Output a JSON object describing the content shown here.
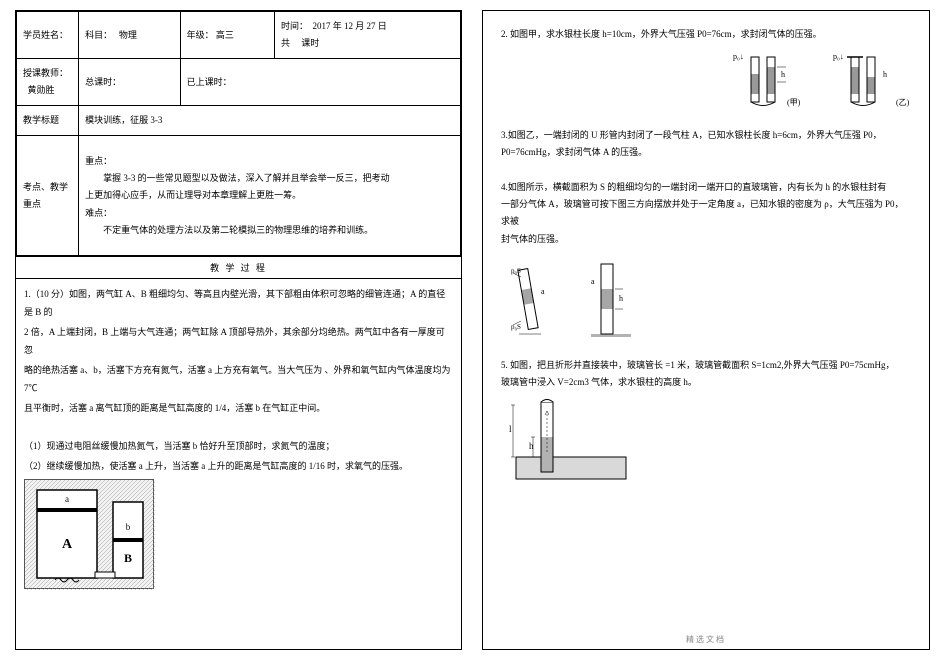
{
  "header": {
    "student_name_label": "学员姓名：",
    "subject_label": "科目：",
    "subject_value": "物理",
    "grade_label": "年级：",
    "grade_value": "高三",
    "time_label": "时间：",
    "time_value": "2017 年 12 月 27 日",
    "total_periods_label": "共",
    "total_periods_unit": "课时",
    "teacher_label": "授课教师：",
    "teacher_value": "黄勋胜",
    "total_lessons_label": "总课时：",
    "attended_lessons_label": "已上课时：",
    "goal_label": "教学标题",
    "goal_value": "模块训练，征服 3-3",
    "keypoint_label": "考点、教学重点",
    "keypoint_intro": "重点：",
    "keypoint_line1": "掌握 3-3 的一些常见题型以及做法，深入了解并且举会举一反三，把考动",
    "keypoint_line2": "上更加得心应手，从而让理导对本章理解上更胜一筹。",
    "difficult_intro": "难点：",
    "difficult_value": "不定重气体的处理方法以及第二轮模拟三的物理思维的培养和训练。",
    "process_title": "教 学 过 程"
  },
  "left_body": {
    "q1_head": "1.（10 分）如图，两气缸 A、B 粗细均匀、等高且内壁光滑，其下部粗由体积可忽略的细管连通；A 的直径是 B 的",
    "q1_l2": "2 倍，A 上端封闭，B 上端与大气连通；两气缸除 A 顶部导热外，其余部分均绝热。两气缸中各有一厚度可忽",
    "q1_l3": "略的绝热活塞 a、b，活塞下方充有氮气，活塞 a 上方充有氧气。当大气压为 、外界和氧气缸内气体温度均为 7℃",
    "q1_l4": "且平衡时，活塞 a 离气缸顶的距离是气缸高度的 1/4，活塞 b 在气缸正中间。",
    "sub1": "（1）现通过电阻丝缓慢加热氮气，当活塞 b 恰好升至顶部时，求氮气的温度；",
    "sub2": "（2）继续缓慢加热，使活塞 a 上升，当活塞 a 上升的距离是气缸高度的 1/16 时，求氧气的压强。",
    "labels": {
      "A": "A",
      "B": "B",
      "a": "a",
      "b": "b"
    }
  },
  "right": {
    "q2": "2. 如图甲，求水银柱长度 h=10cm，外界大气压强 P0=76cm，求封闭气体的压强。",
    "q2_labels": {
      "P0": "p₀↓",
      "h": "h",
      "mark1": "(甲)",
      "mark2": "(乙)"
    },
    "q3_l1": "3.如图乙，一端封闭的 U 形管内封闭了一段气柱 A，已知水银柱长度 h=6cm，外界大气压强 P0，",
    "q3_l2": "P0=76cmHg，求封闭气体 A 的压强。",
    "q4_l1": "4.如图所示，横截面积为 S 的粗细均匀的一端封闭一端开口的直玻璃管，内有长为 h 的水银柱封有",
    "q4_l2": "一部分气体 A，玻璃管可按下图三方向摆放并处于一定角度 a，已知水银的密度为 ρ，大气压强为 P0，求被",
    "q4_l3": "封气体的压强。",
    "q4_labels": {
      "P0S_top": "p₀S",
      "P0S_bot": "p₀S",
      "a": "a",
      "h": "h"
    },
    "q5_l1": "5. 如图，把且折形并直接装中，玻璃管长   =1 米，玻璃管截面积 S=1cm2,外界大气压强 P0=75cmHg，",
    "q5_l2": "玻璃管中浸入 V=2cm3 气体，求水银柱的高度 h。",
    "q5_labels": {
      "l": "l",
      "h": "h"
    }
  },
  "footer": "精选文档"
}
